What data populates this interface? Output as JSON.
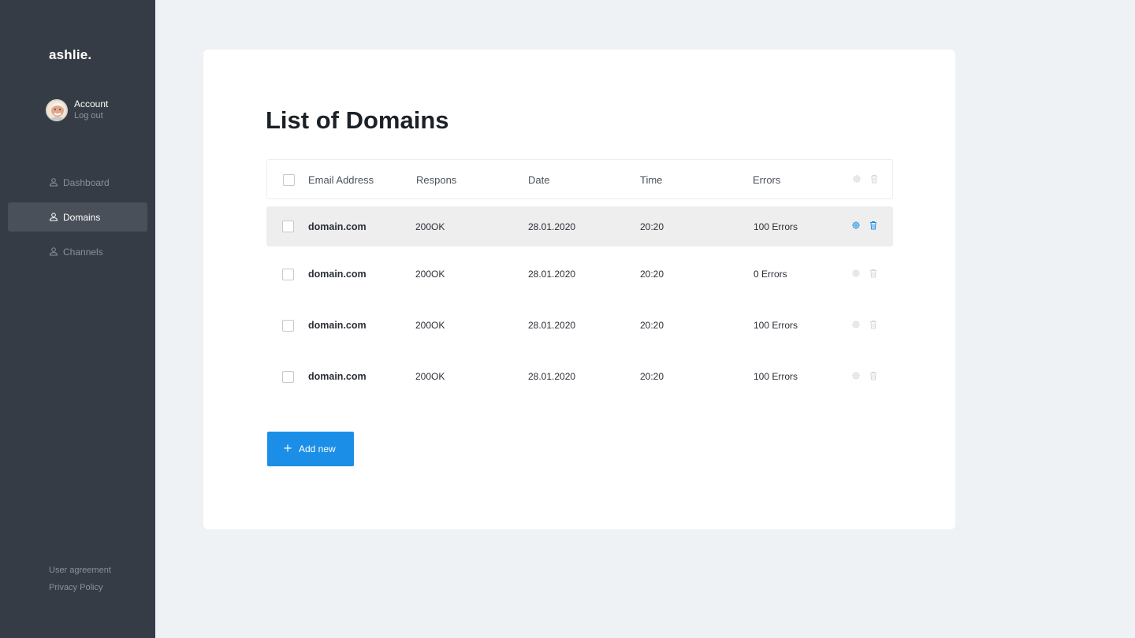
{
  "sidebar": {
    "brand": "ashlie.",
    "account": {
      "label": "Account",
      "logout": "Log out"
    },
    "items": [
      {
        "label": "Dashboard",
        "icon": "user-icon",
        "active": false
      },
      {
        "label": "Domains",
        "icon": "user-icon",
        "active": true
      },
      {
        "label": "Channels",
        "icon": "user-icon",
        "active": false
      }
    ],
    "footer": {
      "user_agreement": "User agreement",
      "privacy_policy": "Privacy Policy"
    }
  },
  "main": {
    "title": "List of Domains",
    "table": {
      "columns": [
        "Email Address",
        "Respons",
        "Date",
        "Time",
        "Errors"
      ],
      "rows": [
        {
          "domain": "domain.com",
          "response": "200OK",
          "date": "28.01.2020",
          "time": "20:20",
          "errors": "100 Errors",
          "highlighted": true
        },
        {
          "domain": "domain.com",
          "response": "200OK",
          "date": "28.01.2020",
          "time": "20:20",
          "errors": "0 Errors",
          "highlighted": false
        },
        {
          "domain": "domain.com",
          "response": "200OK",
          "date": "28.01.2020",
          "time": "20:20",
          "errors": "100 Errors",
          "highlighted": false
        },
        {
          "domain": "domain.com",
          "response": "200OK",
          "date": "28.01.2020",
          "time": "20:20",
          "errors": "100 Errors",
          "highlighted": false
        }
      ]
    },
    "add_button": {
      "label": "Add new",
      "icon": "plus-icon"
    }
  },
  "colors": {
    "sidebar_bg": "#363c45",
    "active_nav_bg": "#4a5059",
    "page_bg": "#eff2f5",
    "accent": "#1b8fe8",
    "row_highlight": "#eeeeee"
  }
}
